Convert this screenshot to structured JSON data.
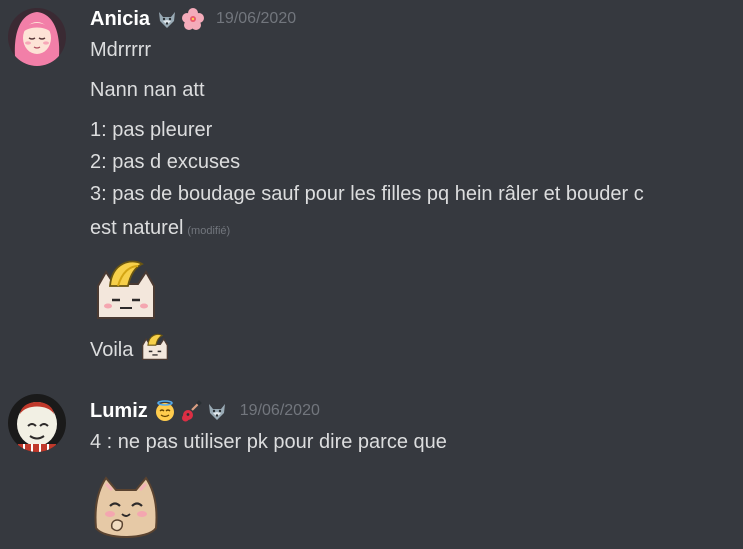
{
  "messages": [
    {
      "author": "Anicia",
      "badges": [
        "wolf-emoji",
        "hibiscus-emoji"
      ],
      "timestamp": "19/06/2020",
      "lines": [
        "Mdrrrrr",
        "Nann nan att",
        "1: pas pleurer",
        "2: pas d excuses",
        "3: pas de boudage sauf pour les filles pq hein râler et bouder c",
        "est naturel"
      ],
      "edited_label": "(modifié)",
      "sticker": "banana-cat-emoji",
      "after_sticker_text": "Voila",
      "inline_emoji": "banana-cat-emoji"
    },
    {
      "author": "Lumiz",
      "badges": [
        "angel-emoji",
        "guitar-emoji",
        "wolf-emoji"
      ],
      "timestamp": "19/06/2020",
      "lines": [
        "4 : ne pas utiliser pk pour dire parce que"
      ],
      "sticker": "blushing-cat-emoji"
    }
  ],
  "colors": {
    "background": "#36393f",
    "username": "#ffffff",
    "text": "#dcddde",
    "muted": "#72767d"
  }
}
